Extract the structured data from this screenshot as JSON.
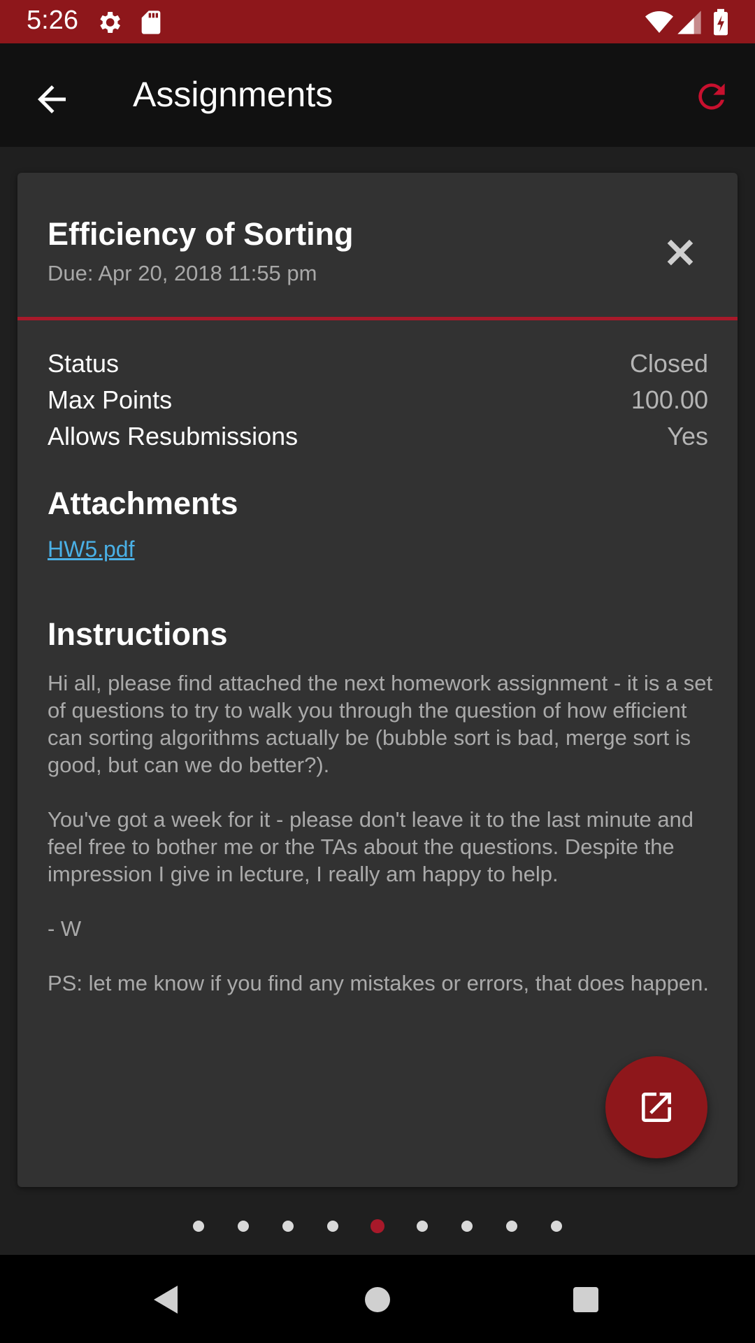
{
  "status_bar": {
    "time": "5:26",
    "icons": [
      "settings-icon",
      "sd-card-icon",
      "wifi-icon",
      "signal-icon",
      "battery-icon"
    ]
  },
  "app_bar": {
    "title": "Assignments",
    "back_icon": "arrow-back-icon",
    "refresh_icon": "refresh-icon",
    "refresh_color": "#c8102e"
  },
  "card": {
    "title": "Efficiency of Sorting",
    "due": "Due: Apr 20, 2018 11:55 pm",
    "close_icon": "close-icon",
    "info": [
      {
        "label": "Status",
        "value": "Closed"
      },
      {
        "label": "Max Points",
        "value": "100.00"
      },
      {
        "label": "Allows Resubmissions",
        "value": "Yes"
      }
    ],
    "attachments_heading": "Attachments",
    "attachment_link": "HW5.pdf",
    "instructions_heading": "Instructions",
    "instructions": [
      "Hi all, please find attached the next homework assignment - it is a set of questions to try to walk you through the question of how efficient can sorting algorithms actually be (bubble sort is bad, merge sort is good, but can we do better?).",
      "You've got a week for it - please don't leave it to the last minute and feel free to bother me or the TAs about the questions. Despite the impression I give in lecture, I really am happy to help.",
      "- W",
      "PS: let me know if you find any mistakes or errors, that does happen."
    ],
    "fab_icon": "open-in-new-icon"
  },
  "pager": {
    "count": 9,
    "active_index": 4
  },
  "nav_bar": {
    "icons": [
      "nav-back-icon",
      "nav-home-icon",
      "nav-recents-icon"
    ]
  },
  "colors": {
    "accent": "#8e171b",
    "card_bg": "#323232",
    "link": "#4ab0e6"
  }
}
